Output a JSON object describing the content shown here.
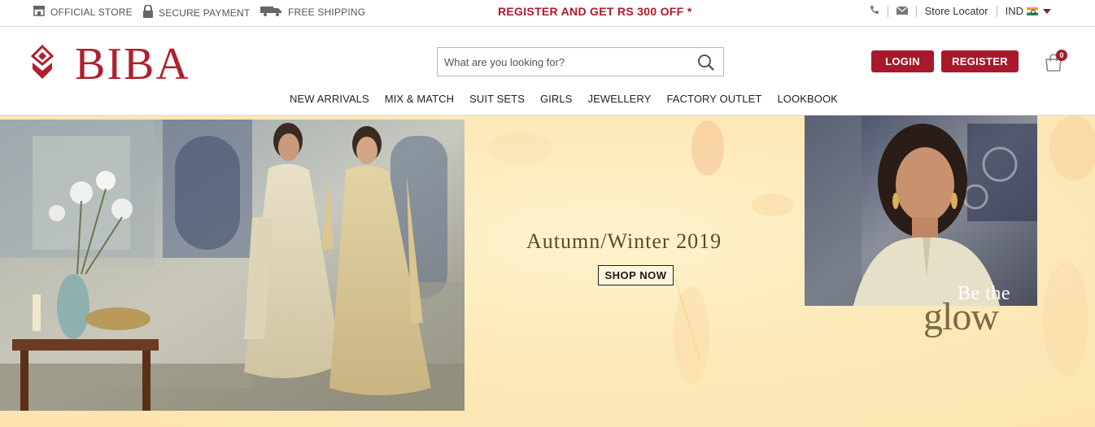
{
  "topbar": {
    "perks": [
      {
        "label": "OFFICIAL STORE",
        "icon": "store-icon"
      },
      {
        "label": "SECURE PAYMENT",
        "icon": "lock-icon"
      },
      {
        "label": "FREE SHIPPING",
        "icon": "truck-icon"
      }
    ],
    "promo": "REGISTER AND GET RS 300 OFF *",
    "store_locator": "Store Locator",
    "country": "IND"
  },
  "header": {
    "logo_text": "BIBA",
    "search_placeholder": "What are you looking for?",
    "login_label": "LOGIN",
    "register_label": "REGISTER",
    "cart_count": "0"
  },
  "nav": {
    "items": [
      "NEW ARRIVALS",
      "MIX & MATCH",
      "SUIT SETS",
      "GIRLS",
      "JEWELLERY",
      "FACTORY OUTLET",
      "LOOKBOOK"
    ]
  },
  "hero": {
    "title": "Autumn/Winter 2019",
    "cta": "SHOP NOW",
    "tagline_1": "Be the",
    "tagline_2": "glow"
  },
  "colors": {
    "brand": "#a7192b",
    "promo": "#b0182a",
    "hero_bg": "#fde9b8"
  }
}
